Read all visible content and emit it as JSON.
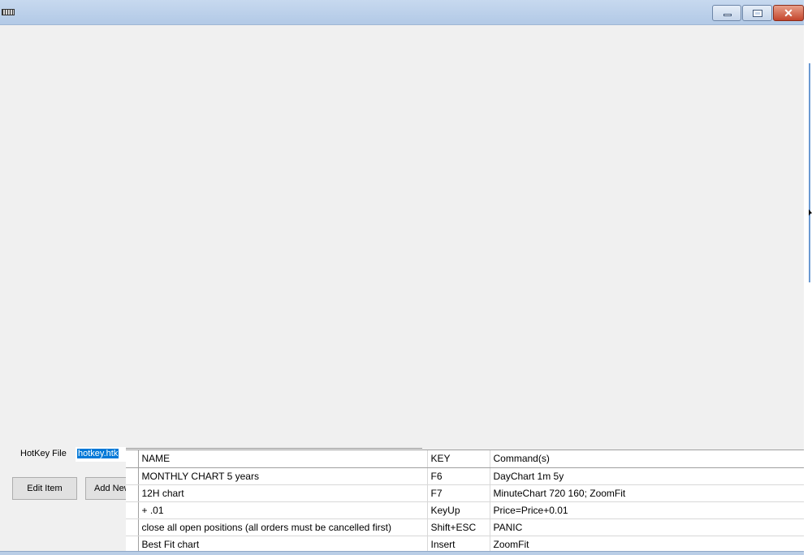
{
  "window": {
    "controls": {
      "minimize_icon": "minimize-icon",
      "maximize_icon": "maximize-icon",
      "close_glyph": "✕"
    }
  },
  "hotkey_file": {
    "label": "HotKey File",
    "value": "hotkey.htk"
  },
  "buttons": {
    "edit_item": "Edit Item",
    "add_new": "Add New"
  },
  "table": {
    "headers": [
      "NAME",
      "KEY",
      "Command(s)"
    ],
    "rows": [
      {
        "name": "MONTHLY CHART 5 years",
        "key": "F6",
        "command": "DayChart 1m 5y"
      },
      {
        "name": "12H chart",
        "key": "F7",
        "command": "MinuteChart 720 160; ZoomFit"
      },
      {
        "name": "+ .01",
        "key": "KeyUp",
        "command": "Price=Price+0.01"
      },
      {
        "name": "close all open positions (all orders must be cancelled first)",
        "key": "Shift+ESC",
        "command": "PANIC"
      },
      {
        "name": "Best Fit chart",
        "key": "Insert",
        "command": "ZoomFit"
      }
    ]
  },
  "colors": {
    "selection": "#0078d7",
    "titlebar": "#c7d9ef",
    "close_button": "#c4452c"
  }
}
